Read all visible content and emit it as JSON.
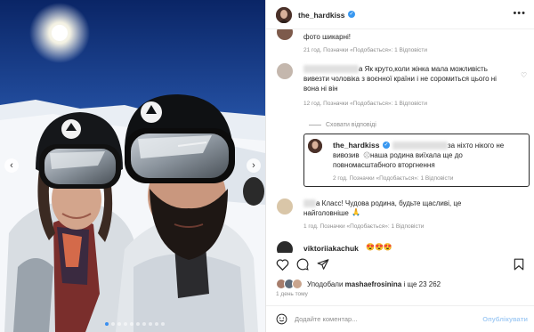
{
  "post": {
    "username": "the_hardkiss",
    "more_label": "•••"
  },
  "comments": [
    {
      "text": "фото шикарні!",
      "meta": "21 год.   Позначки «Подобається»: 1   Відповісти"
    },
    {
      "text_line1": "а Як круто,коли жінка мала можливість",
      "text_line2": "вивезти чоловіка з воєнної країни і не соромиться цього ні",
      "text_line3": "вона ні він",
      "meta": "12 год.   Позначки «Подобається»: 1   Відповісти"
    },
    {
      "hide_replies": "Сховати відповіді"
    },
    {
      "username": "the_hardkiss",
      "text_part1": "за ніхто нікого не",
      "text_line2a": "вивозив",
      "text_line2b": " наша родина виїхала ще до",
      "text_line3": "повномасштабного вторгнення",
      "meta": "2 год.   Позначки «Подобається»: 1   Відповісти"
    },
    {
      "text_line1": "а Класс! Чудова родина, будьте щасливі, це",
      "text_line2": "найголовніше",
      "meta": "1 год.   Позначки «Подобається»: 1   Відповісти"
    },
    {
      "username": "viktoriiakachuk",
      "emojis": "😍😍😍"
    }
  ],
  "likes": {
    "prefix": "Уподобали ",
    "user": "mashaefrosinina",
    "suffix": " і ще 23 262"
  },
  "posted": "1 день тому",
  "comment_bar": {
    "placeholder": "Додайте коментар...",
    "publish": "Опублікувати"
  },
  "colors": {
    "verified": "#3897f0",
    "carousel_active_dot": "#3a8ff0",
    "publish_text": "#a7cef5"
  },
  "carousel": {
    "prev_icon": "chevron-left-icon",
    "next_icon": "chevron-right-icon",
    "dot_count": 10,
    "active_index": 0
  }
}
